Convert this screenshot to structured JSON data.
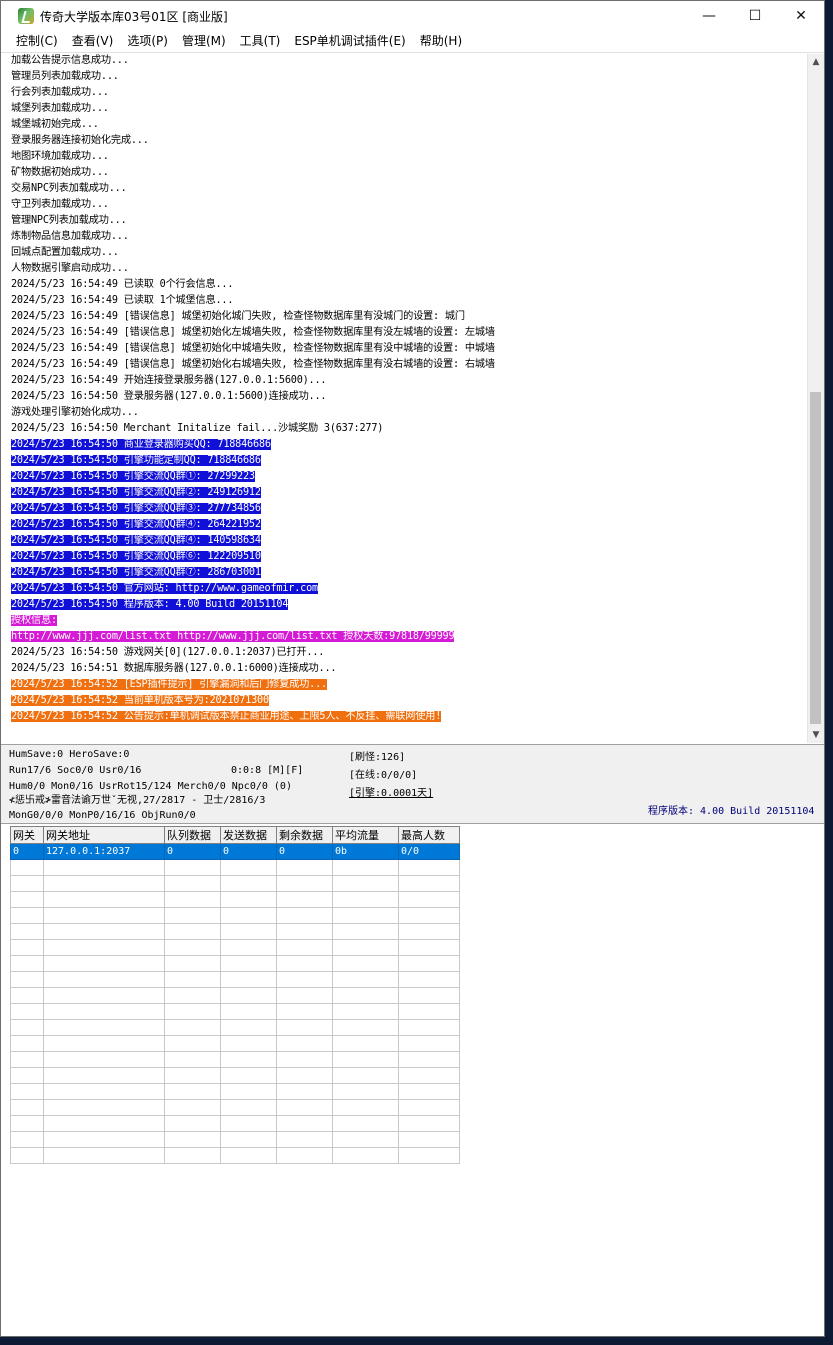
{
  "window": {
    "title": "传奇大学版本库03号01区 [商业版]",
    "minimize": "—",
    "maximize": "☐",
    "close": "✕"
  },
  "menu": [
    "控制(C)",
    "查看(V)",
    "选项(P)",
    "管理(M)",
    "工具(T)",
    "ESP单机调试插件(E)",
    "帮助(H)"
  ],
  "log": [
    {
      "text": "加载公告提示信息成功...",
      "style": ""
    },
    {
      "text": "管理员列表加载成功...",
      "style": ""
    },
    {
      "text": "行会列表加载成功...",
      "style": ""
    },
    {
      "text": "城堡列表加载成功...",
      "style": ""
    },
    {
      "text": "城堡城初始完成...",
      "style": ""
    },
    {
      "text": "登录服务器连接初始化完成...",
      "style": ""
    },
    {
      "text": "地图环境加载成功...",
      "style": ""
    },
    {
      "text": "矿物数据初始成功...",
      "style": ""
    },
    {
      "text": "交易NPC列表加载成功...",
      "style": ""
    },
    {
      "text": "守卫列表加载成功...",
      "style": ""
    },
    {
      "text": "管理NPC列表加载成功...",
      "style": ""
    },
    {
      "text": "炼制物品信息加载成功...",
      "style": ""
    },
    {
      "text": "回城点配置加载成功...",
      "style": ""
    },
    {
      "text": "人物数据引擎启动成功...",
      "style": ""
    },
    {
      "text": "2024/5/23 16:54:49 已读取 0个行会信息...",
      "style": ""
    },
    {
      "text": "2024/5/23 16:54:49 已读取 1个城堡信息...",
      "style": ""
    },
    {
      "text": "2024/5/23 16:54:49 [错误信息] 城堡初始化城门失败, 检查怪物数据库里有没城门的设置: 城门",
      "style": ""
    },
    {
      "text": "2024/5/23 16:54:49 [错误信息] 城堡初始化左城墙失败, 检查怪物数据库里有没左城墙的设置: 左城墙",
      "style": ""
    },
    {
      "text": "2024/5/23 16:54:49 [错误信息] 城堡初始化中城墙失败, 检查怪物数据库里有没中城墙的设置: 中城墙",
      "style": ""
    },
    {
      "text": "2024/5/23 16:54:49 [错误信息] 城堡初始化右城墙失败, 检查怪物数据库里有没右城墙的设置: 右城墙",
      "style": ""
    },
    {
      "text": "2024/5/23 16:54:49 开始连接登录服务器(127.0.0.1:5600)...",
      "style": ""
    },
    {
      "text": "2024/5/23 16:54:50 登录服务器(127.0.0.1:5600)连接成功...",
      "style": ""
    },
    {
      "text": "游戏处理引擎初始化成功...",
      "style": ""
    },
    {
      "text": "2024/5/23 16:54:50 Merchant Initalize fail...沙城奖励 3(637:277)",
      "style": ""
    },
    {
      "text": "2024/5/23 16:54:50 商业登录器购买QQ: 718846686",
      "style": "blue"
    },
    {
      "text": "2024/5/23 16:54:50 引擎功能定制QQ: 718846686",
      "style": "blue"
    },
    {
      "text": "2024/5/23 16:54:50 引擎交流QQ群①: 27299223",
      "style": "blue"
    },
    {
      "text": "2024/5/23 16:54:50 引擎交流QQ群②: 249126912",
      "style": "blue"
    },
    {
      "text": "2024/5/23 16:54:50 引擎交流QQ群③: 277734856",
      "style": "blue"
    },
    {
      "text": "2024/5/23 16:54:50 引擎交流QQ群④: 264221952",
      "style": "blue"
    },
    {
      "text": "2024/5/23 16:54:50 引擎交流QQ群④: 140598634",
      "style": "blue"
    },
    {
      "text": "2024/5/23 16:54:50 引擎交流QQ群⑥: 122209510",
      "style": "blue"
    },
    {
      "text": "2024/5/23 16:54:50 引擎交流QQ群⑦: 286703001",
      "style": "blue"
    },
    {
      "text": "2024/5/23 16:54:50 官方网站: http://www.gameofmir.com",
      "style": "blue"
    },
    {
      "text": "2024/5/23 16:54:50 程序版本: 4.00 Build 20151104",
      "style": "blue"
    },
    {
      "text": "授权信息:",
      "style": "magenta"
    },
    {
      "text": "http://www.jjj.com/list.txt http://www.jjj.com/list.txt 授权天数:97818/99999",
      "style": "magenta"
    },
    {
      "text": "2024/5/23 16:54:50 游戏网关[0](127.0.0.1:2037)已打开...",
      "style": ""
    },
    {
      "text": "2024/5/23 16:54:51 数据库服务器(127.0.0.1:6000)连接成功...",
      "style": ""
    },
    {
      "text": "2024/5/23 16:54:52 [ESP插件提示] 引擎漏洞和后门修复成功...",
      "style": "orange"
    },
    {
      "text": "2024/5/23 16:54:52 当前单机版本号为:2021071300",
      "style": "orange"
    },
    {
      "text": "2024/5/23 16:54:52 公告提示:单机调试版本禁止商业用途、上限5人、不反挂、需联网使用!",
      "style": "orange"
    }
  ],
  "scroll": {
    "up": "▲",
    "down": "▼"
  },
  "status": {
    "line1": "HumSave:0 HeroSave:0",
    "line2": "Run17/6 Soc0/0 Usr0/16",
    "line2b": "0:0:8 [M][F]",
    "line3": "Hum0/0 Mon0/16 UsrRot15/124 Merch0/0 Npc0/0 (0)",
    "line4": "≮惩卐戒≯雷音法谕万世ˇ无视,27/2817 - 卫士/2816/3",
    "line5": "MonG0/0/0 MonP0/16/16 ObjRun0/0",
    "refresh": "[刷怪:126]",
    "online": "[在线:0/0/0]",
    "engine": "[引擎:0.0001天]",
    "version": "程序版本: 4.00 Build 20151104"
  },
  "grid": {
    "columns": [
      "网关",
      "网关地址",
      "队列数据",
      "发送数据",
      "剩余数据",
      "平均流量",
      "最高人数"
    ],
    "rows": [
      [
        "0",
        "127.0.0.1:2037",
        "0",
        "0",
        "0",
        "0b",
        "0/0"
      ]
    ],
    "empty_rows": 19
  }
}
